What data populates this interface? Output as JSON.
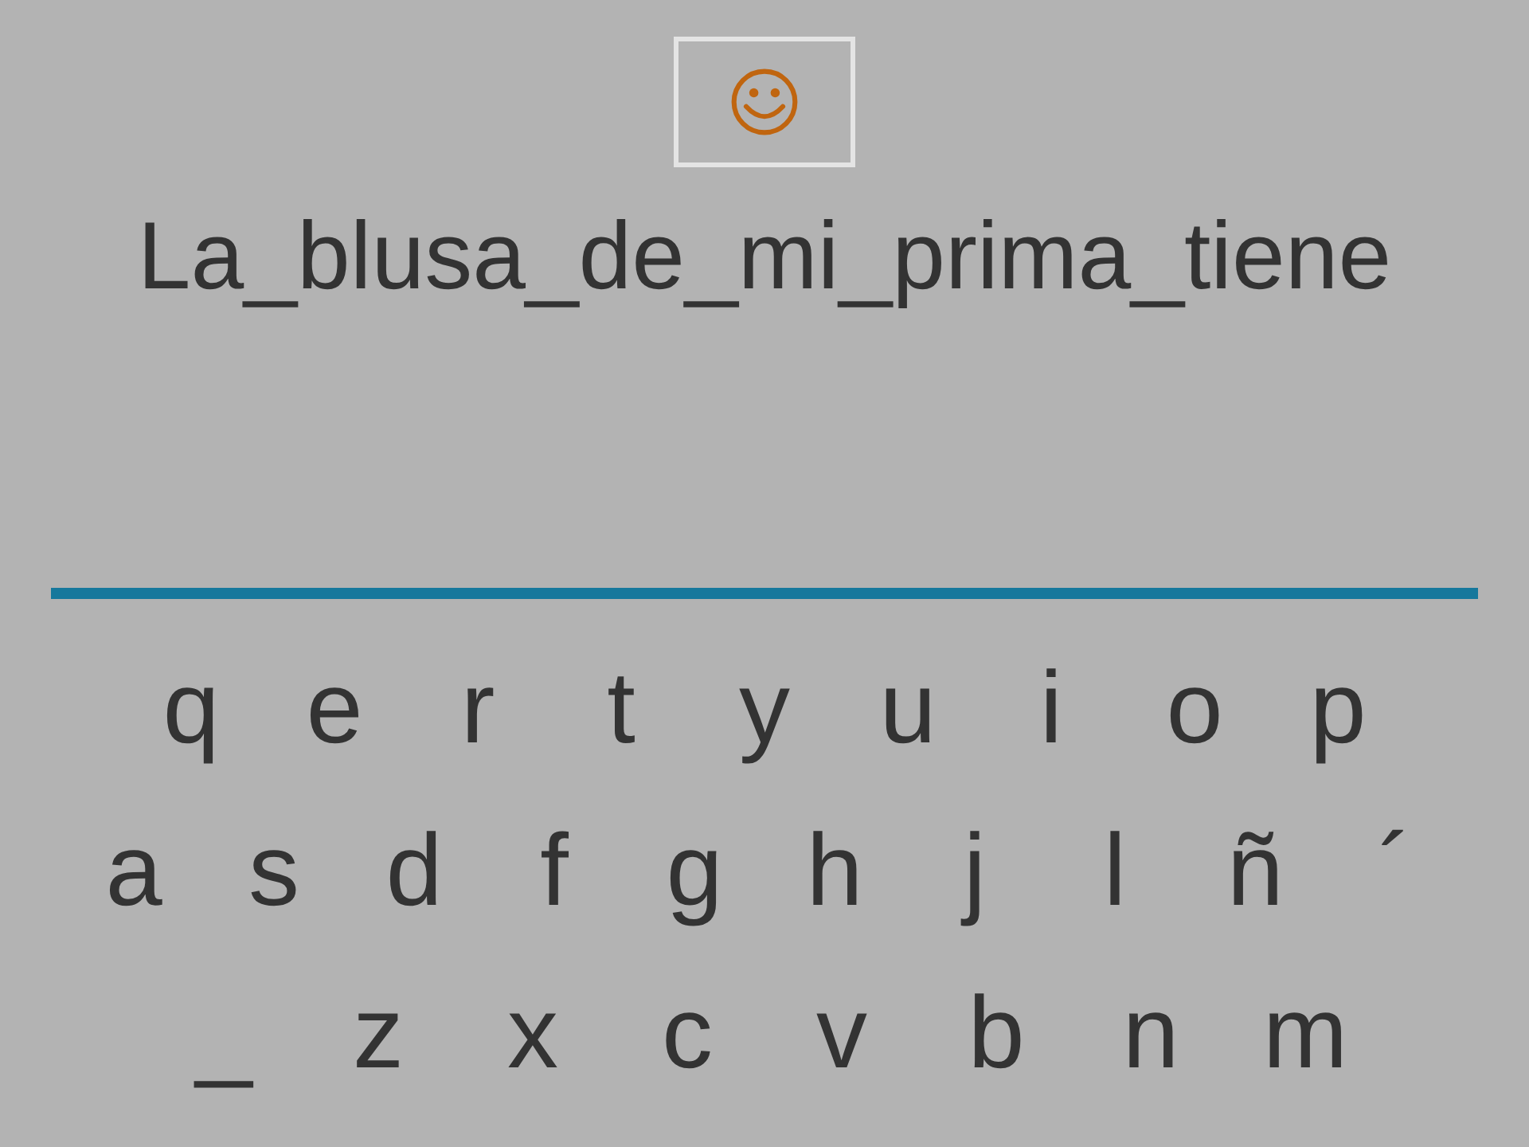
{
  "phrase": "La_blusa_de_mi_prima_tiene",
  "keyboard": {
    "rows": [
      [
        "q",
        "e",
        "r",
        "t",
        "y",
        "u",
        "i",
        "o",
        "p"
      ],
      [
        "a",
        "s",
        "d",
        "f",
        "g",
        "h",
        "j",
        "l",
        "ñ",
        "´"
      ],
      [
        "_",
        "z",
        "x",
        "c",
        "v",
        "b",
        "n",
        "m"
      ]
    ]
  }
}
